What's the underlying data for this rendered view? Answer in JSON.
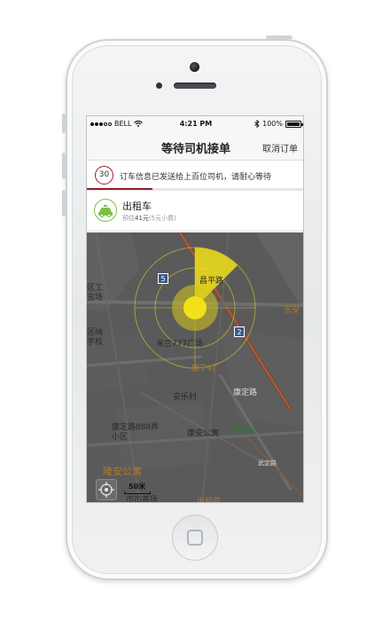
{
  "status_bar": {
    "carrier": "BELL",
    "time": "4:21 PM",
    "battery": "100%",
    "signal_icon": "signal-dots-icon",
    "wifi_icon": "wifi-icon",
    "bluetooth_icon": "bluetooth-icon",
    "battery_icon": "battery-icon"
  },
  "nav": {
    "title": "等待司机接单",
    "cancel_label": "取消订单"
  },
  "notice": {
    "countdown": "30",
    "message": "订车信息已发送给上百位司机，请耐心等待",
    "progress_fraction": 0.3
  },
  "car": {
    "name": "出租车",
    "price_prefix": "预估",
    "price_amount": "41元",
    "price_suffix": "(5元小费)",
    "icon": "taxi-icon",
    "accent_color": "#7bbf4a"
  },
  "map": {
    "labels": {
      "road_1": "昌平路",
      "plaza": "米兰777广场",
      "village_1": "康宁村",
      "village_2": "安乐村",
      "road_2": "康定路",
      "lane": "康定路888弄",
      "lane_sub": "小区",
      "apartment_1": "康安公寓",
      "village_3": "绿杨村",
      "apartment_2": "隆安公寓",
      "left_1": "区工",
      "left_2": "宫场",
      "left_3": "区纳",
      "left_4": "学校",
      "right_1": "东安",
      "bottom_1": "市市茶场",
      "bottom_2": "中船花",
      "road_3": "武定路",
      "road_sign_1": "5",
      "road_sign_2": "2"
    },
    "scale": "50米",
    "locate_icon": "locate-icon",
    "radar_color": "#f2e11a"
  },
  "colors": {
    "brand": "#9b1c2a",
    "map_bg": "#575757"
  }
}
